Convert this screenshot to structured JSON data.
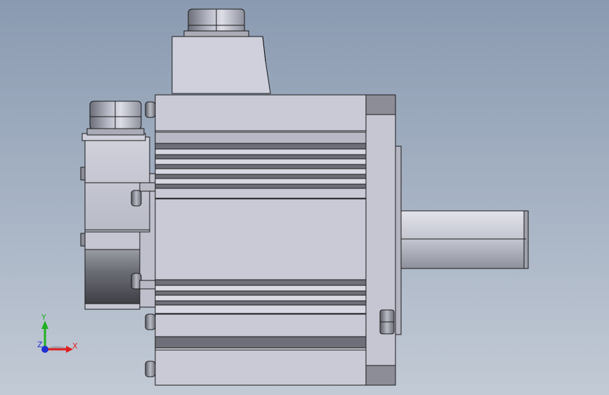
{
  "viewport": {
    "background_top": "#8a9ab0",
    "background_bottom": "#c2cad5"
  },
  "model": {
    "description_icon": "servo-motor-side-view",
    "body_color": "#c9cad6",
    "edge_color": "#1a1a1a",
    "dark_shade": "#6e6e6e"
  },
  "triad": {
    "x_label": "X",
    "y_label": "Y",
    "z_label": "Z",
    "x_color": "#e02020",
    "y_color": "#20b020",
    "z_color": "#2030d0"
  }
}
